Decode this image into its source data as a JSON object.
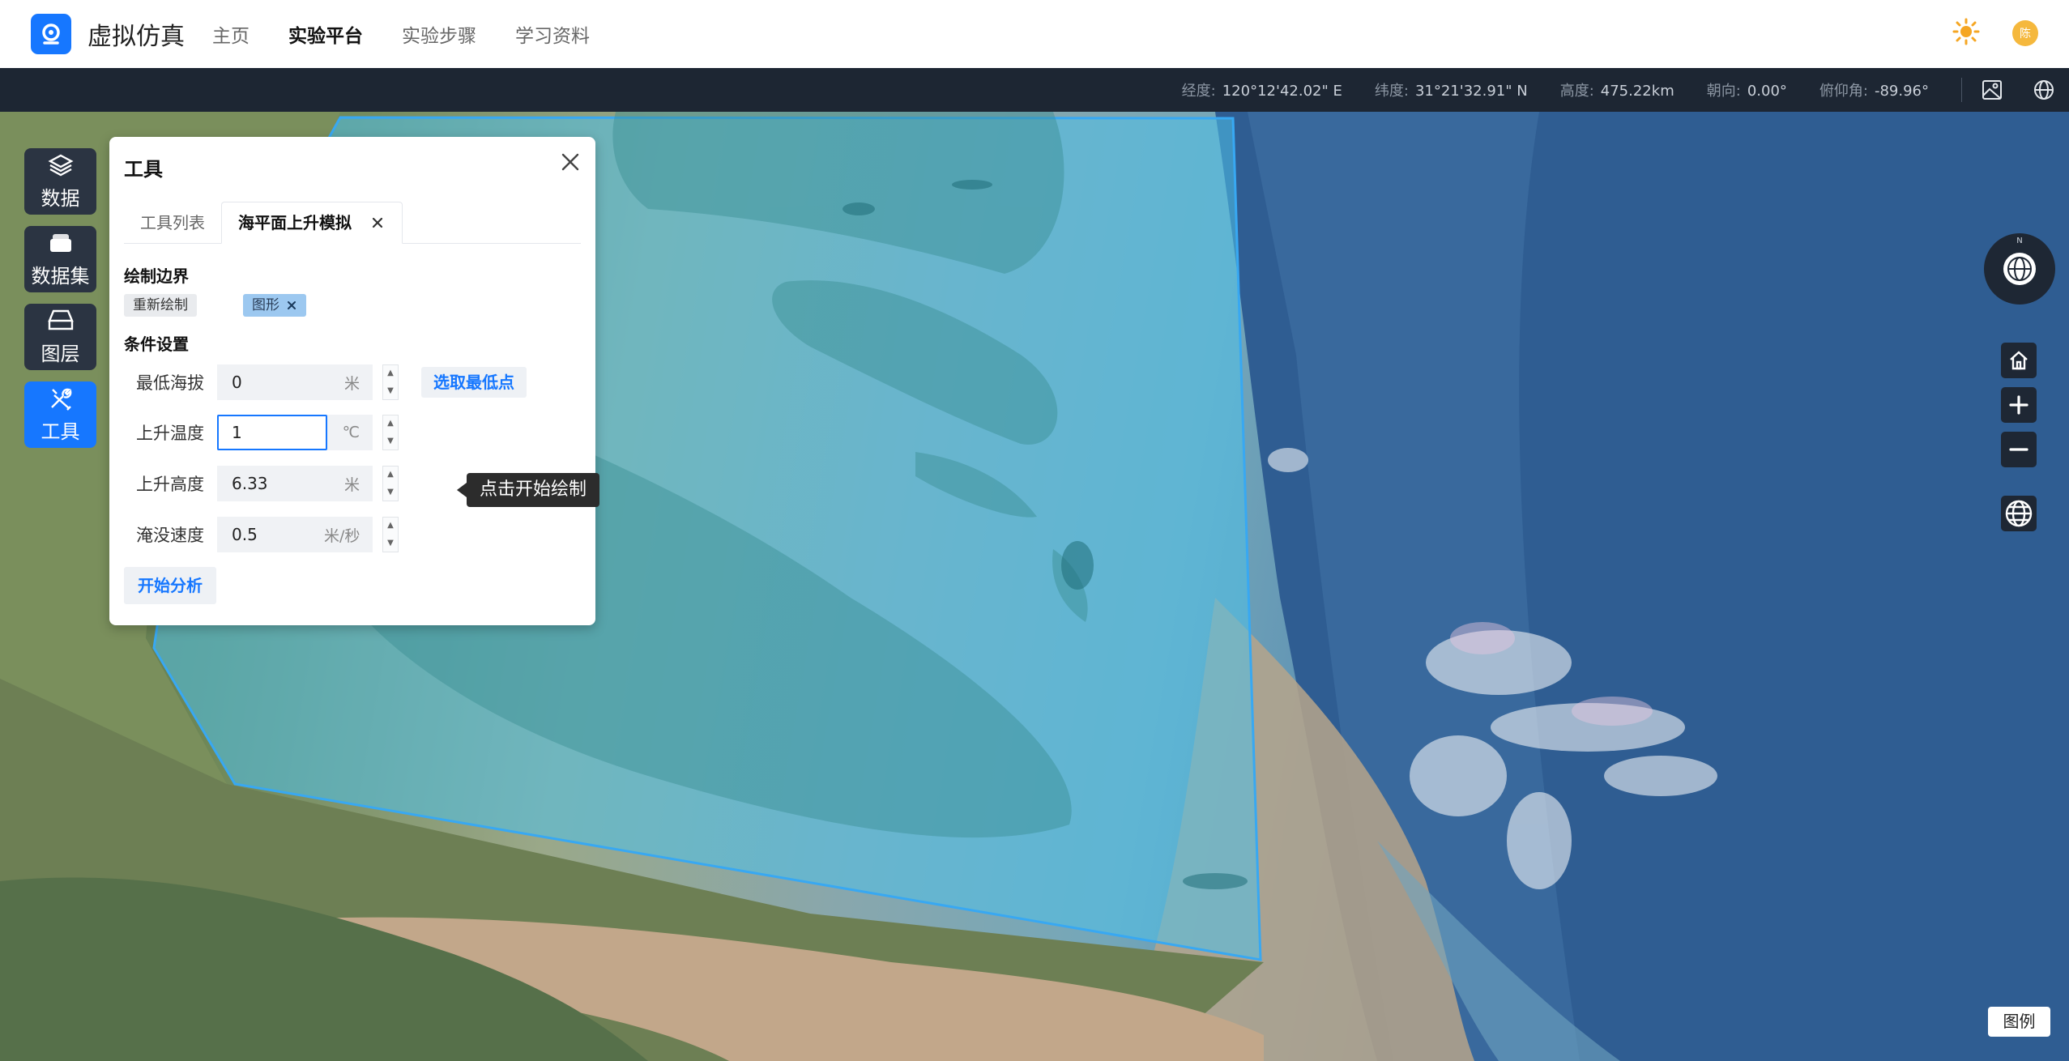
{
  "app": {
    "title": "虚拟仿真",
    "nav": [
      "主页",
      "实验平台",
      "实验步骤",
      "学习资料"
    ],
    "active_nav": "实验平台",
    "avatar_text": "陈"
  },
  "status": {
    "lon_label": "经度:",
    "lon_value": "120°12'42.02\" E",
    "lat_label": "纬度:",
    "lat_value": "31°21'32.91\" N",
    "alt_label": "高度:",
    "alt_value": "475.22km",
    "heading_label": "朝向:",
    "heading_value": "0.00°",
    "pitch_label": "俯仰角:",
    "pitch_value": "-89.96°"
  },
  "left_toolbar": [
    {
      "label": "数据",
      "icon": "layers-icon"
    },
    {
      "label": "数据集",
      "icon": "dataset-icon"
    },
    {
      "label": "图层",
      "icon": "layer-plane-icon"
    },
    {
      "label": "工具",
      "icon": "tools-icon",
      "active": true
    }
  ],
  "panel": {
    "title": "工具",
    "tabs": [
      "工具列表",
      "海平面上升模拟"
    ],
    "active_tab": "海平面上升模拟",
    "draw_section": "绘制边界",
    "redraw_label": "重新绘制",
    "shape_tag": "图形",
    "cond_section": "条件设置",
    "fields": [
      {
        "label": "最低海拔",
        "value": "0",
        "unit": "米"
      },
      {
        "label": "上升温度",
        "value": "1",
        "unit": "℃"
      },
      {
        "label": "上升高度",
        "value": "6.33",
        "unit": "米"
      },
      {
        "label": "淹没速度",
        "value": "0.5",
        "unit": "米/秒"
      }
    ],
    "pick_lowest_label": "选取最低点",
    "start_label": "开始分析"
  },
  "tooltip": "点击开始绘制",
  "compass_n": "N",
  "legend_label": "图例",
  "colors": {
    "accent": "#1677ff",
    "topbar_dark": "#1d2633",
    "polygon_fill": "#4ec1ea",
    "polygon_stroke": "#38a8f2"
  }
}
